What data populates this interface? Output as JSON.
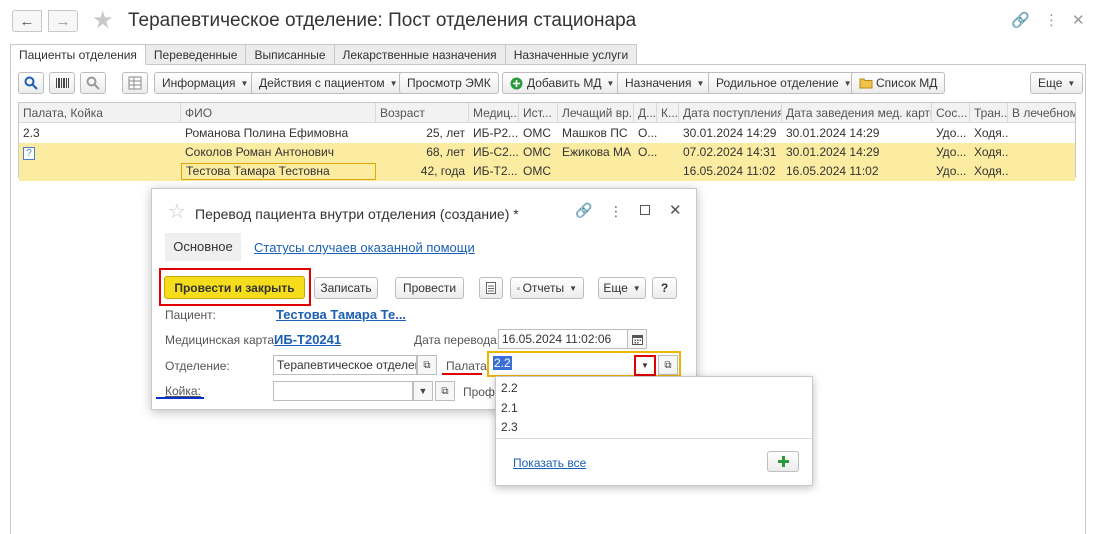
{
  "window": {
    "title": "Терапевтическое отделение: Пост отделения стационара"
  },
  "tabs": [
    {
      "label": "Пациенты отделения",
      "active": true
    },
    {
      "label": "Переведенные"
    },
    {
      "label": "Выписанные"
    },
    {
      "label": "Лекарственные назначения"
    },
    {
      "label": "Назначенные услуги"
    }
  ],
  "toolbar": {
    "info": "Информация",
    "actions": "Действия с пациентом",
    "emk": "Просмотр ЭМК",
    "add_md": "Добавить МД",
    "appointments": "Назначения",
    "parent_dept": "Родильное отделение",
    "md_list": "Список МД",
    "more": "Еще"
  },
  "table": {
    "columns": [
      "Палата, Койка",
      "ФИО",
      "Возраст",
      "Медиц...",
      "Ист...",
      "Лечащий вр...",
      "Д...",
      "К...",
      "Дата поступления",
      "Дата заведения мед. карты",
      "Сос...",
      "Тран...",
      "В лечебном"
    ],
    "rows": [
      {
        "room": "2.3",
        "name": "Романова Полина Ефимовна",
        "age": "25,  лет",
        "card": "ИБ-Р2...",
        "source": "ОМС",
        "doctor": "Машков ПС",
        "d": "О...",
        "k": "",
        "admit": "30.01.2024 14:29",
        "card_date": "30.01.2024 14:29",
        "state": "Удо...",
        "transport": "Ходя...",
        "highlighted": false
      },
      {
        "room": "",
        "name": "Соколов Роман Антонович",
        "age": "68,  лет",
        "card": "ИБ-С2...",
        "source": "ОМС",
        "doctor": "Ежикова МА",
        "d": "О...",
        "k": "",
        "admit": "07.02.2024 14:31",
        "card_date": "30.01.2024 14:29",
        "state": "Удо...",
        "transport": "Ходя...",
        "highlighted": true
      },
      {
        "room": "",
        "name": "Тестова Тамара Тестовна",
        "age": "42,  года",
        "card": "ИБ-Т2...",
        "source": "ОМС",
        "doctor": "",
        "d": "",
        "k": "",
        "admit": "16.05.2024 11:02",
        "card_date": "16.05.2024 11:02",
        "state": "Удо...",
        "transport": "Ходя...",
        "highlighted": true
      }
    ]
  },
  "dialog": {
    "title": "Перевод пациента внутри отделения (создание) *",
    "tab_main": "Основное",
    "tab_statuses": "Статусы случаев оказанной помощи",
    "btn_post_close": "Провести и закрыть",
    "btn_save": "Записать",
    "btn_post": "Провести",
    "btn_reports": "Отчеты",
    "btn_more": "Еще",
    "btn_help": "?",
    "patient_label": "Пациент:",
    "patient_value": "Тестова Тамара Те...",
    "card_label": "Медицинская карта:",
    "card_value": "ИБ-Т20241",
    "date_label": "Дата перевода:",
    "date_value": "16.05.2024 11:02:06",
    "dept_label": "Отделение:",
    "dept_value": "Терапевтическое отделени",
    "room_label": "Палата:",
    "room_value": "2.2",
    "bed_label": "Койка:",
    "bed_value": "",
    "profile_label": "Профи"
  },
  "dropdown": {
    "items": [
      "2.2",
      "2.1",
      "2.3"
    ],
    "show_all": "Показать все"
  },
  "colors": {
    "highlight_row": "#fbeca2",
    "primary_button": "#f5dd1b",
    "accent_red": "#e00000",
    "accent_blue": "#0033cc",
    "link": "#1a5fb4"
  }
}
